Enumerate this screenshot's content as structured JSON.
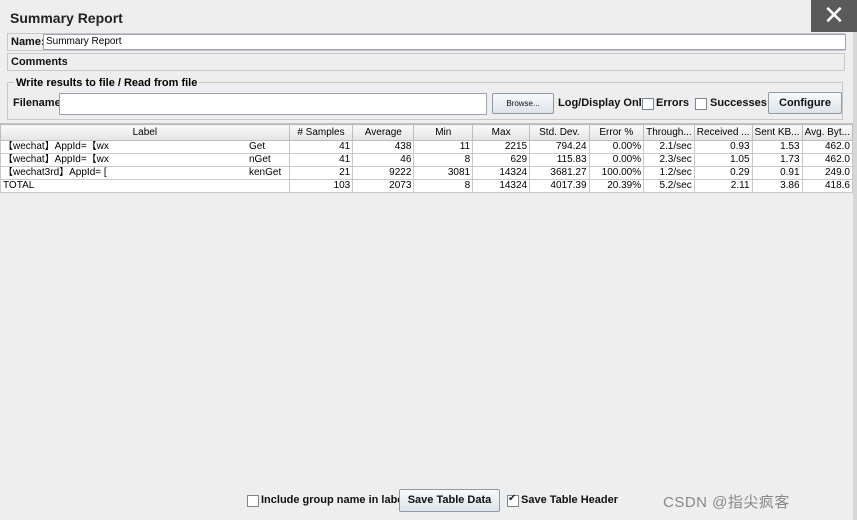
{
  "panel": {
    "title": "Summary Report"
  },
  "form": {
    "name_label": "Name:",
    "name_value": "Summary Report",
    "comments_label": "Comments:"
  },
  "file_group": {
    "title": "Write results to file / Read from file",
    "filename_label": "Filename",
    "filename_value": "",
    "browse_label": "Browse...",
    "log_display_label": "Log/Display Only:",
    "errors_label": "Errors",
    "successes_label": "Successes",
    "configure_label": "Configure"
  },
  "table": {
    "headers": [
      "Label",
      "# Samples",
      "Average",
      "Min",
      "Max",
      "Std. Dev.",
      "Error %",
      "Through...",
      "Received ...",
      "Sent KB...",
      "Avg. Byt..."
    ],
    "rows": [
      [
        "【wechat】AppId=【wx",
        "Get",
        "41",
        "438",
        "11",
        "2215",
        "794.24",
        "0.00%",
        "2.1/sec",
        "0.93",
        "1.53",
        "462.0"
      ],
      [
        "【wechat】AppId=【wx",
        "nGet",
        "41",
        "46",
        "8",
        "629",
        "115.83",
        "0.00%",
        "2.3/sec",
        "1.05",
        "1.73",
        "462.0"
      ],
      [
        "【wechat3rd】AppId= [",
        "kenGet",
        "21",
        "9222",
        "3081",
        "14324",
        "3681.27",
        "100.00%",
        "1.2/sec",
        "0.29",
        "0.91",
        "249.0"
      ],
      [
        "TOTAL",
        "",
        "103",
        "2073",
        "8",
        "14324",
        "4017.39",
        "20.39%",
        "5.2/sec",
        "2.11",
        "3.86",
        "418.6"
      ]
    ]
  },
  "bottom": {
    "include_group_label": "Include group name in label?",
    "save_table_data_label": "Save Table Data",
    "save_table_header_label": "Save Table Header"
  },
  "watermark": "CSDN @指尖疯客"
}
